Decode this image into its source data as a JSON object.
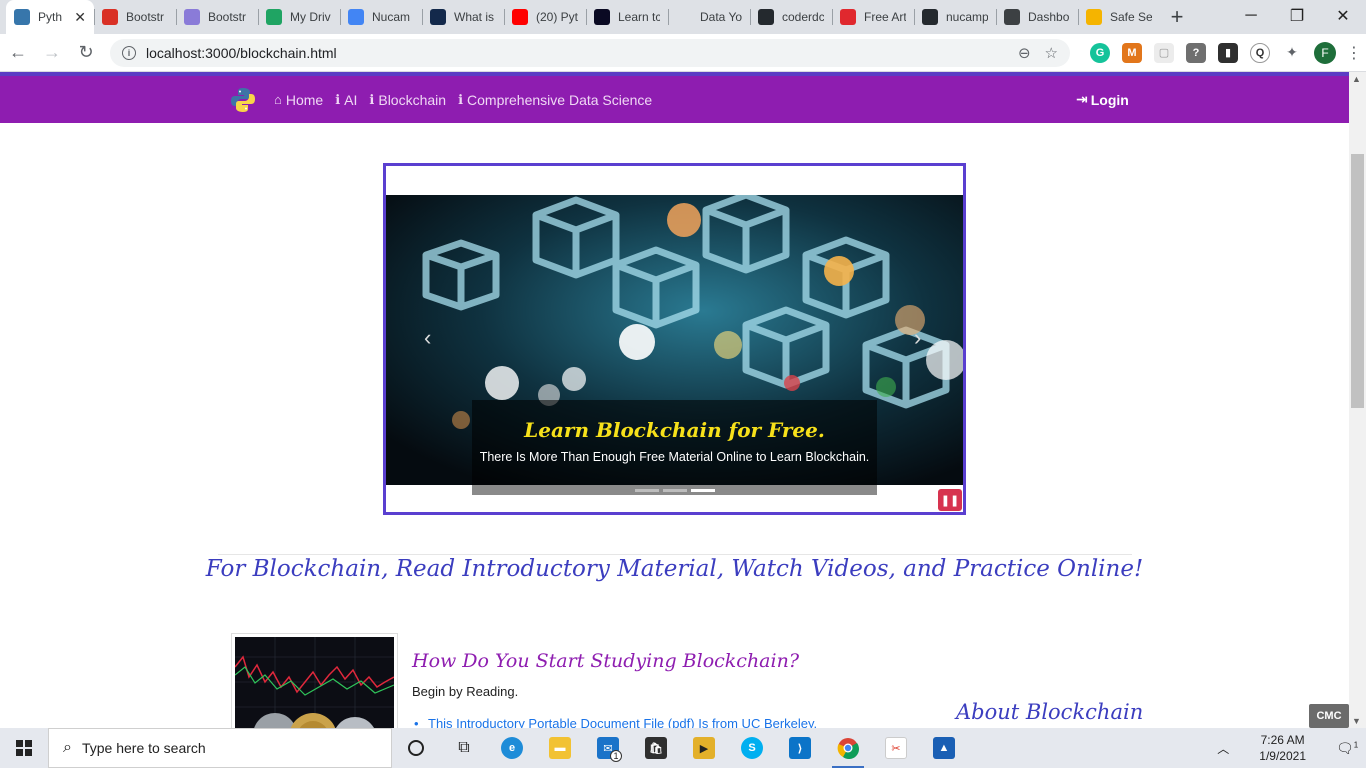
{
  "browser": {
    "tabs": [
      {
        "title": "Pyth",
        "favicon": "python-icon",
        "color": "#3776ab",
        "active": true
      },
      {
        "title": "Bootstr",
        "favicon": "gmail-icon",
        "color": "#d93025"
      },
      {
        "title": "Bootstr",
        "favicon": "r-icon",
        "color": "#8a7bd8"
      },
      {
        "title": "My Driv",
        "favicon": "drive-icon",
        "color": "#1fa463"
      },
      {
        "title": "Nucam",
        "favicon": "docs-icon",
        "color": "#4285f4"
      },
      {
        "title": "What is",
        "favicon": "b-icon",
        "color": "#13294b"
      },
      {
        "title": "(20) Pyt",
        "favicon": "youtube-icon",
        "color": "#ff0000"
      },
      {
        "title": "Learn tc",
        "favicon": "freecodecamp-icon",
        "color": "#0a0a23"
      },
      {
        "title": "Data Yo",
        "favicon": "blank-icon",
        "color": "#dee1e6"
      },
      {
        "title": "coderdc",
        "favicon": "github-icon",
        "color": "#24292e"
      },
      {
        "title": "Free Art",
        "favicon": "u-icon",
        "color": "#e0282e"
      },
      {
        "title": "nucamp",
        "favicon": "github-icon",
        "color": "#24292e"
      },
      {
        "title": "Dashbo",
        "favicon": "dashboard-icon",
        "color": "#3c4043"
      },
      {
        "title": "Safe Se",
        "favicon": "check-icon",
        "color": "#f5b400"
      }
    ],
    "url": "localhost:3000/blockchain.html",
    "profile_initial": "F"
  },
  "site": {
    "nav": {
      "home": "Home",
      "ai": "AI",
      "blockchain": "Blockchain",
      "data_science": "Comprehensive Data Science",
      "login": "Login"
    },
    "carousel": {
      "caption_title": "Learn Blockchain for Free.",
      "caption_text": "There Is More Than Enough Free Material Online to Learn Blockchain.",
      "slide_count": 3,
      "active_slide": 3
    },
    "headline": "For Blockchain, Read Introductory Material, Watch Videos, and Practice Online!",
    "section": {
      "heading": "How Do You Start Studying Blockchain?",
      "intro": "Begin by Reading.",
      "link1": "This Introductory Portable Document File (pdf) Is from UC Berkeley."
    },
    "aside_heading": "About Blockchain"
  },
  "overlay_badge": "CMC",
  "taskbar": {
    "search_placeholder": "Type here to search",
    "time": "7:26 AM",
    "date": "1/9/2021",
    "mail_badge": "1",
    "notif_badge": "1"
  },
  "colors": {
    "navbar": "#8e1db0",
    "frame": "#5a3fd0",
    "caption_title": "#f7e11a",
    "headline": "#3b3dbf"
  }
}
